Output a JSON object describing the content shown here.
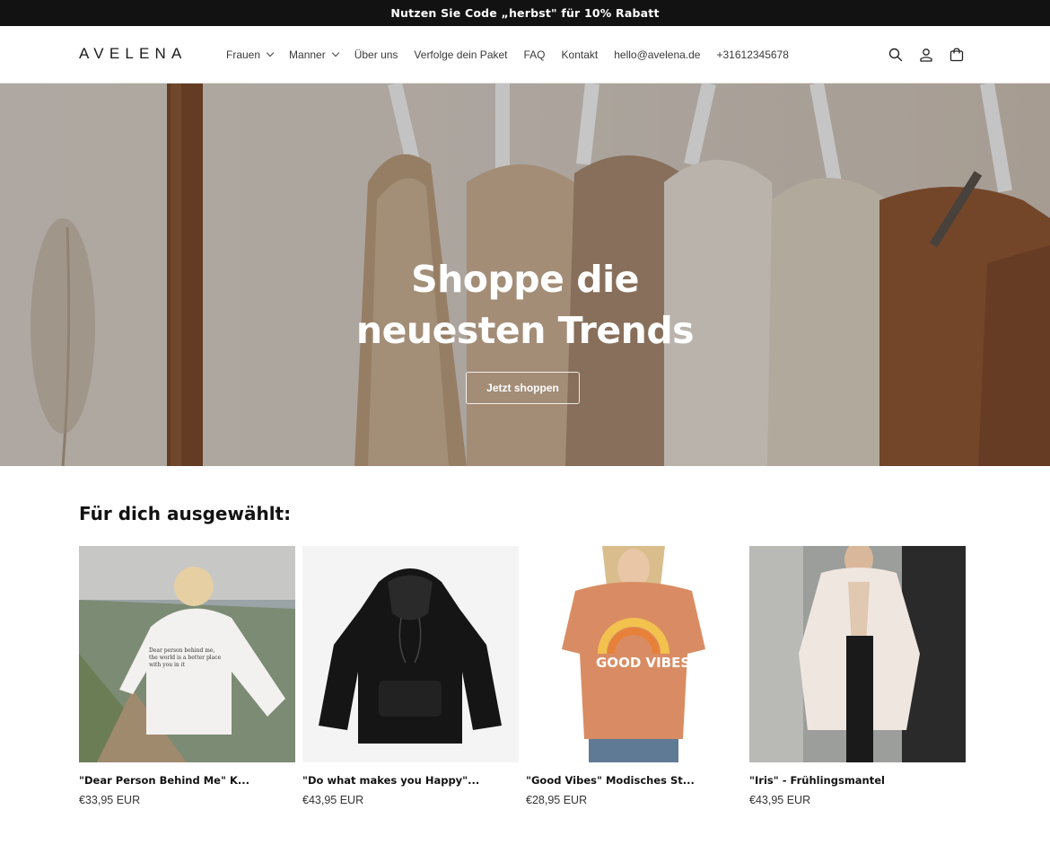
{
  "announcement": {
    "text": "Nutzen Sie Code „herbst\" für 10% Rabatt"
  },
  "header": {
    "logo": "AVELENA",
    "nav": [
      {
        "label": "Frauen",
        "has_dropdown": true
      },
      {
        "label": "Manner",
        "has_dropdown": true
      },
      {
        "label": "Über uns",
        "has_dropdown": false
      },
      {
        "label": "Verfolge dein Paket",
        "has_dropdown": false
      },
      {
        "label": "FAQ",
        "has_dropdown": false
      },
      {
        "label": "Kontakt",
        "has_dropdown": false
      },
      {
        "label": "hello@avelena.de",
        "has_dropdown": false
      },
      {
        "label": "+31612345678",
        "has_dropdown": false
      }
    ],
    "icons": [
      "search-icon",
      "account-icon",
      "cart-icon"
    ]
  },
  "hero": {
    "title_line1": "Shoppe die",
    "title_line2": "neuesten Trends",
    "button_label": "Jetzt shoppen"
  },
  "featured": {
    "title": "Für dich ausgewählt:",
    "products": [
      {
        "title": "\"Dear Person Behind Me\" K...",
        "price": "€33,95 EUR"
      },
      {
        "title": "\"Do what makes you Happy\"...",
        "price": "€43,95 EUR"
      },
      {
        "title": "\"Good Vibes\" Modisches St...",
        "price": "€28,95 EUR"
      },
      {
        "title": "\"Iris\" - Frühlingsmantel",
        "price": "€43,95 EUR"
      }
    ]
  },
  "colors": {
    "announcement_bg": "#121212",
    "text": "#121212",
    "price": "#333333"
  }
}
